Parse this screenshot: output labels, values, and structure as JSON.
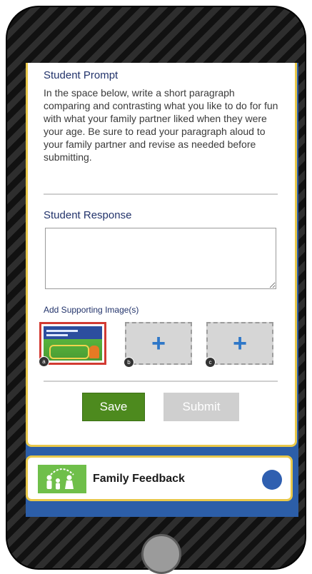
{
  "prompt": {
    "title": "Student Prompt",
    "text": "In the space below, write a short paragraph comparing and contrasting what you like to do for fun with what your family partner liked when they were your age. Be sure to read your paragraph aloud to your family partner and revise as needed before submitting."
  },
  "response": {
    "title": "Student Response",
    "value": "",
    "placeholder": ""
  },
  "images": {
    "title": "Add Supporting Image(s)",
    "slots": [
      {
        "badge": "a",
        "state": "filled",
        "icon": "screenshot-thumbnail"
      },
      {
        "badge": "b",
        "state": "empty",
        "icon": "plus-icon"
      },
      {
        "badge": "c",
        "state": "empty",
        "icon": "plus-icon"
      }
    ]
  },
  "actions": {
    "save_label": "Save",
    "submit_label": "Submit"
  },
  "feedback": {
    "label": "Family Feedback",
    "icon": "family-icon"
  },
  "colors": {
    "accent_blue": "#2c5ea8",
    "card_border": "#e9c84a",
    "save_green": "#4d8a1e",
    "disabled_gray": "#cfcfcf",
    "selected_red": "#d23a32"
  }
}
